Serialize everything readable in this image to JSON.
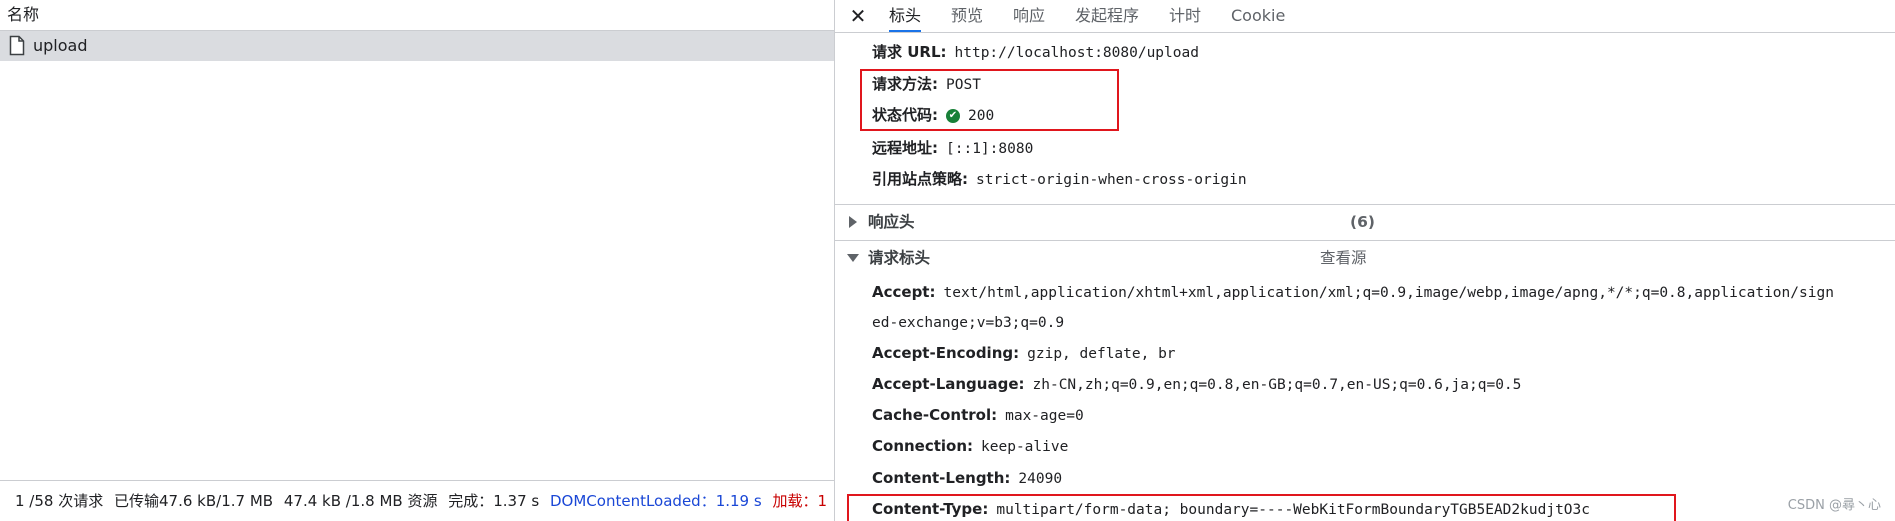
{
  "left_panel": {
    "column_header": "名称",
    "requests": [
      {
        "name": "upload"
      }
    ],
    "status_bar": {
      "requests": "1 /58 次请求",
      "transferred": "已传输47.6 kB/1.7 MB",
      "resources": "47.4 kB /1.8 MB 资源",
      "finish": "完成：1.37 s",
      "dom_content_loaded": "DOMContentLoaded：1.19 s",
      "load": "加载：1"
    }
  },
  "tabs": {
    "close_icon": "close-icon",
    "items": [
      "标头",
      "预览",
      "响应",
      "发起程序",
      "计时",
      "Cookie"
    ],
    "active": "标头"
  },
  "general": {
    "request_url": {
      "key": "请求 URL:",
      "value": "http://localhost:8080/upload"
    },
    "request_method": {
      "key": "请求方法:",
      "value": "POST"
    },
    "status_code": {
      "key": "状态代码:",
      "value": "200",
      "icon": "check-circle-icon",
      "icon_color": "#188038"
    },
    "remote_address": {
      "key": "远程地址:",
      "value": "[::1]:8080"
    },
    "referrer_policy": {
      "key": "引用站点策略:",
      "value": "strict-origin-when-cross-origin"
    }
  },
  "response_headers": {
    "title": "响应头",
    "count": "(6)"
  },
  "request_headers": {
    "title": "请求标头",
    "view_source": "查看源",
    "accept": {
      "key": "Accept:",
      "value_line1": "text/html,application/xhtml+xml,application/xml;q=0.9,image/webp,image/apng,*/*;q=0.8,application/sign",
      "value_line2": "ed-exchange;v=b3;q=0.9"
    },
    "accept_encoding": {
      "key": "Accept-Encoding:",
      "value": "gzip, deflate, br"
    },
    "accept_language": {
      "key": "Accept-Language:",
      "value": "zh-CN,zh;q=0.9,en;q=0.8,en-GB;q=0.7,en-US;q=0.6,ja;q=0.5"
    },
    "cache_control": {
      "key": "Cache-Control:",
      "value": "max-age=0"
    },
    "connection": {
      "key": "Connection:",
      "value": "keep-alive"
    },
    "content_length": {
      "key": "Content-Length:",
      "value": "24090"
    },
    "content_type": {
      "key": "Content-Type:",
      "value": "multipart/form-data; boundary=----WebKitFormBoundaryTGB5EAD2kudjtO3c"
    }
  },
  "watermark": "CSDN @尋丶心",
  "colors": {
    "highlight_box": "#e0161d",
    "active_tab": "#1a73e8",
    "dcl_text": "#1a47d6",
    "load_text": "#c80000"
  }
}
